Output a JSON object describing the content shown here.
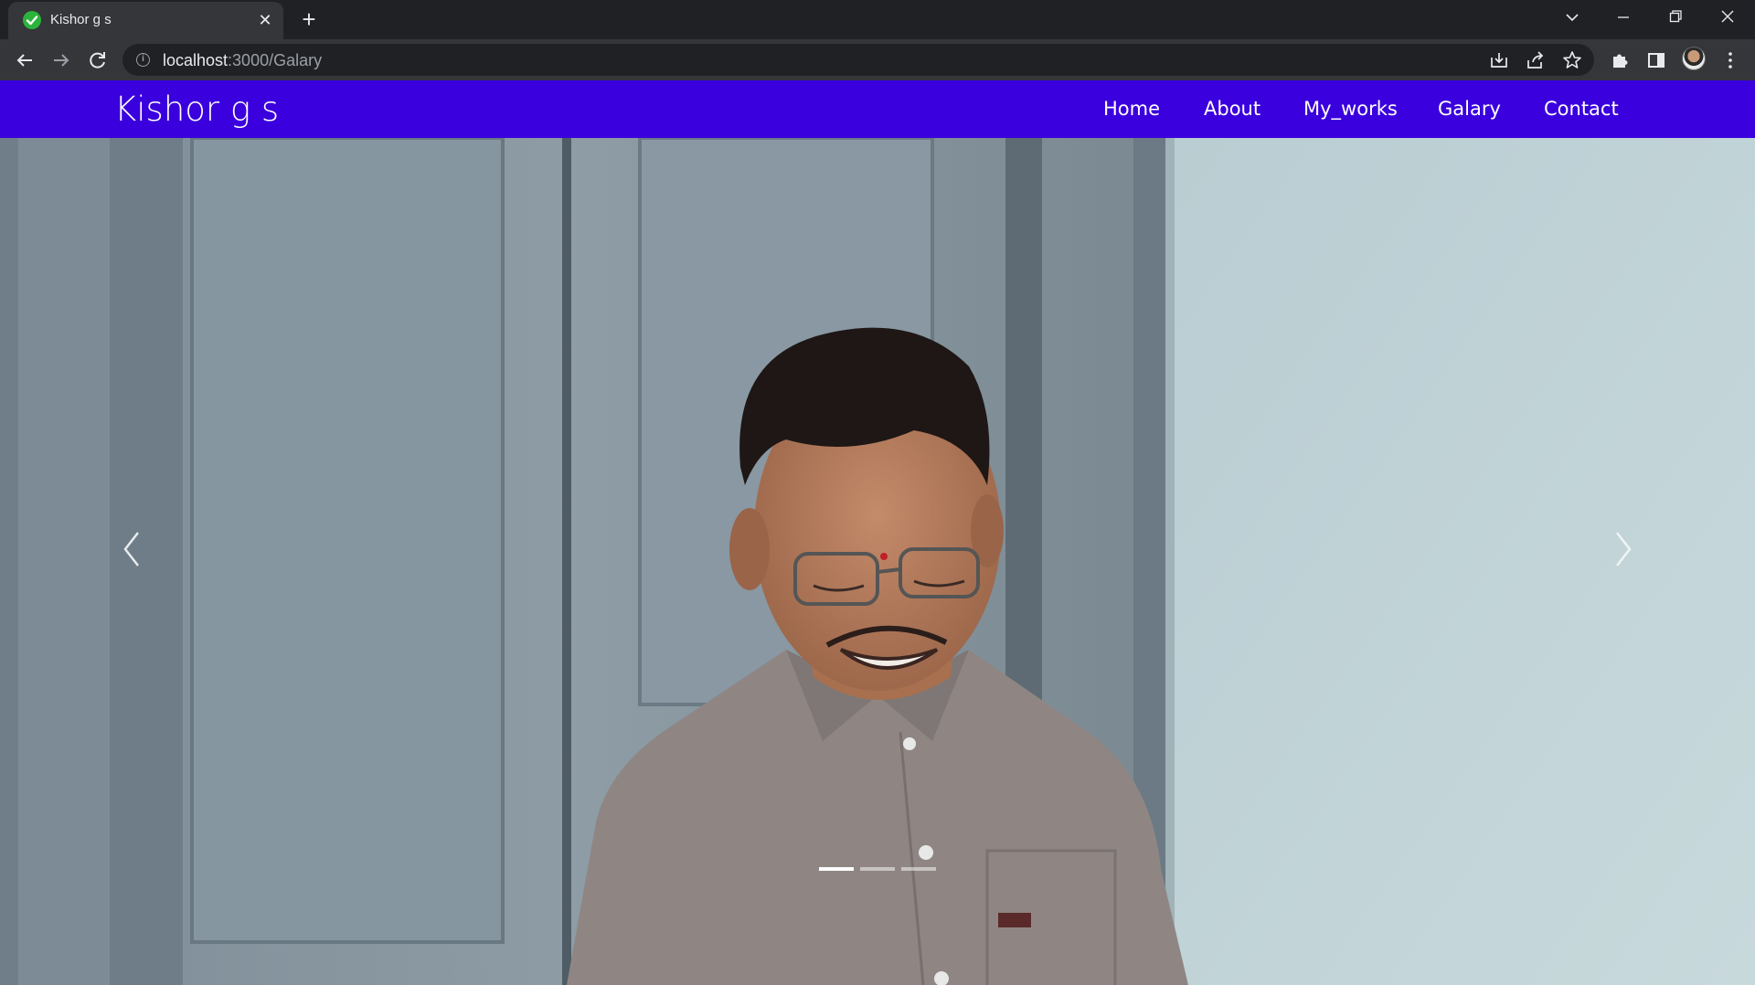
{
  "browser": {
    "tab_title": "Kishor g s",
    "url_host": "localhost",
    "url_path": ":3000/Galary",
    "icons": [
      "check-favicon-icon",
      "close-icon",
      "plus-icon",
      "chevron-down-icon",
      "minimize-icon",
      "restore-icon",
      "window-close-icon",
      "back-icon",
      "forward-icon",
      "reload-icon",
      "info-icon",
      "install-icon",
      "share-icon",
      "star-icon",
      "puzzle-icon",
      "side-panel-icon",
      "profile-avatar",
      "menu-dots-icon"
    ]
  },
  "site": {
    "brand": "Kishor g s",
    "nav": [
      {
        "label": "Home"
      },
      {
        "label": "About"
      },
      {
        "label": "My_works"
      },
      {
        "label": "Galary"
      },
      {
        "label": "Contact"
      }
    ],
    "navbar_color": "#3a00dd"
  },
  "carousel": {
    "slide_count": 3,
    "active_index": 0,
    "image_alt": "Smiling young man with glasses wearing a patterned grey shirt against a wall"
  }
}
